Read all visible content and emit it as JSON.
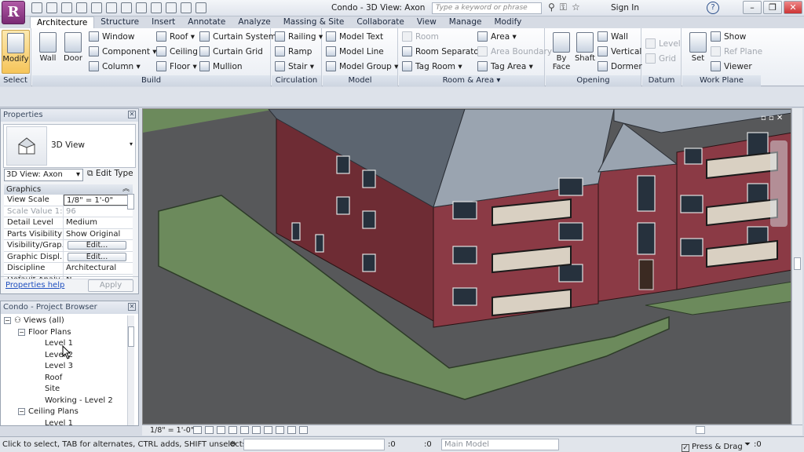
{
  "app": {
    "logo_letter": "R",
    "title": "Condo - 3D View: Axon",
    "search_placeholder": "Type a keyword or phrase",
    "signin": "Sign In"
  },
  "tabs": [
    "Architecture",
    "Structure",
    "Insert",
    "Annotate",
    "Analyze",
    "Massing & Site",
    "Collaborate",
    "View",
    "Manage",
    "Modify"
  ],
  "ribbon": {
    "select": {
      "title": "Select",
      "modify": "Modify"
    },
    "build": {
      "title": "Build",
      "wall": "Wall",
      "door": "Door",
      "window": "Window",
      "component": "Component",
      "column": "Column",
      "roof": "Roof",
      "ceiling": "Ceiling",
      "floor": "Floor",
      "curtain_system": "Curtain System",
      "curtain_grid": "Curtain Grid",
      "mullion": "Mullion"
    },
    "circulation": {
      "title": "Circulation",
      "railing": "Railing",
      "ramp": "Ramp",
      "stair": "Stair"
    },
    "model": {
      "title": "Model",
      "model_text": "Model Text",
      "model_line": "Model Line",
      "model_group": "Model Group"
    },
    "room_area": {
      "title": "Room & Area",
      "room": "Room",
      "room_separator": "Room Separator",
      "tag_room": "Tag Room",
      "area": "Area",
      "area_boundary": "Area Boundary",
      "tag_area": "Tag Area"
    },
    "opening": {
      "title": "Opening",
      "by_face_1": "By",
      "by_face_2": "Face",
      "shaft": "Shaft",
      "wall": "Wall",
      "vertical": "Vertical",
      "dormer": "Dormer"
    },
    "datum": {
      "title": "Datum",
      "level": "Level",
      "grid": "Grid"
    },
    "work_plane": {
      "title": "Work Plane",
      "set": "Set",
      "show": "Show",
      "ref_plane": "Ref Plane",
      "viewer": "Viewer"
    }
  },
  "properties": {
    "title": "Properties",
    "type_name": "3D View",
    "view_selector": "3D View: Axon",
    "edit_type": "Edit Type",
    "group": "Graphics",
    "rows": [
      {
        "k": "View Scale",
        "v": "1/8\" = 1'-0\""
      },
      {
        "k": "Scale Value    1:",
        "v": "96"
      },
      {
        "k": "Detail Level",
        "v": "Medium"
      },
      {
        "k": "Parts Visibility",
        "v": "Show Original"
      },
      {
        "k": "Visibility/Grap...",
        "v": "Edit..."
      },
      {
        "k": "Graphic Displ...",
        "v": "Edit..."
      },
      {
        "k": "Discipline",
        "v": "Architectural"
      },
      {
        "k": "Default Analy...",
        "v": "N..."
      }
    ],
    "help": "Properties help",
    "apply": "Apply"
  },
  "browser": {
    "title": "Condo - Project Browser",
    "nodes": [
      {
        "label": "Views (all)",
        "level": 0,
        "toggle": "-"
      },
      {
        "label": "Floor Plans",
        "level": 1,
        "toggle": "-"
      },
      {
        "label": "Level 1",
        "level": 2
      },
      {
        "label": "Level 2",
        "level": 2
      },
      {
        "label": "Level 3",
        "level": 2
      },
      {
        "label": "Roof",
        "level": 2
      },
      {
        "label": "Site",
        "level": 2
      },
      {
        "label": "Working - Level 2",
        "level": 2
      },
      {
        "label": "Ceiling Plans",
        "level": 1,
        "toggle": "-"
      },
      {
        "label": "Level 1",
        "level": 2
      }
    ]
  },
  "view_control": {
    "scale": "1/8\" = 1'-0\""
  },
  "status": {
    "message": "Click to select, TAB for alternates, CTRL adds, SHIFT unselects.",
    "count1": ":0",
    "count2": ":0",
    "model": "Main Model",
    "press_drag": "Press & Drag",
    "filter_count": ":0"
  },
  "colors": {
    "accent": "#7a2a74",
    "wall": "#8b3a45",
    "ground": "#6c8a5c",
    "roof": "#9aa4b0"
  }
}
